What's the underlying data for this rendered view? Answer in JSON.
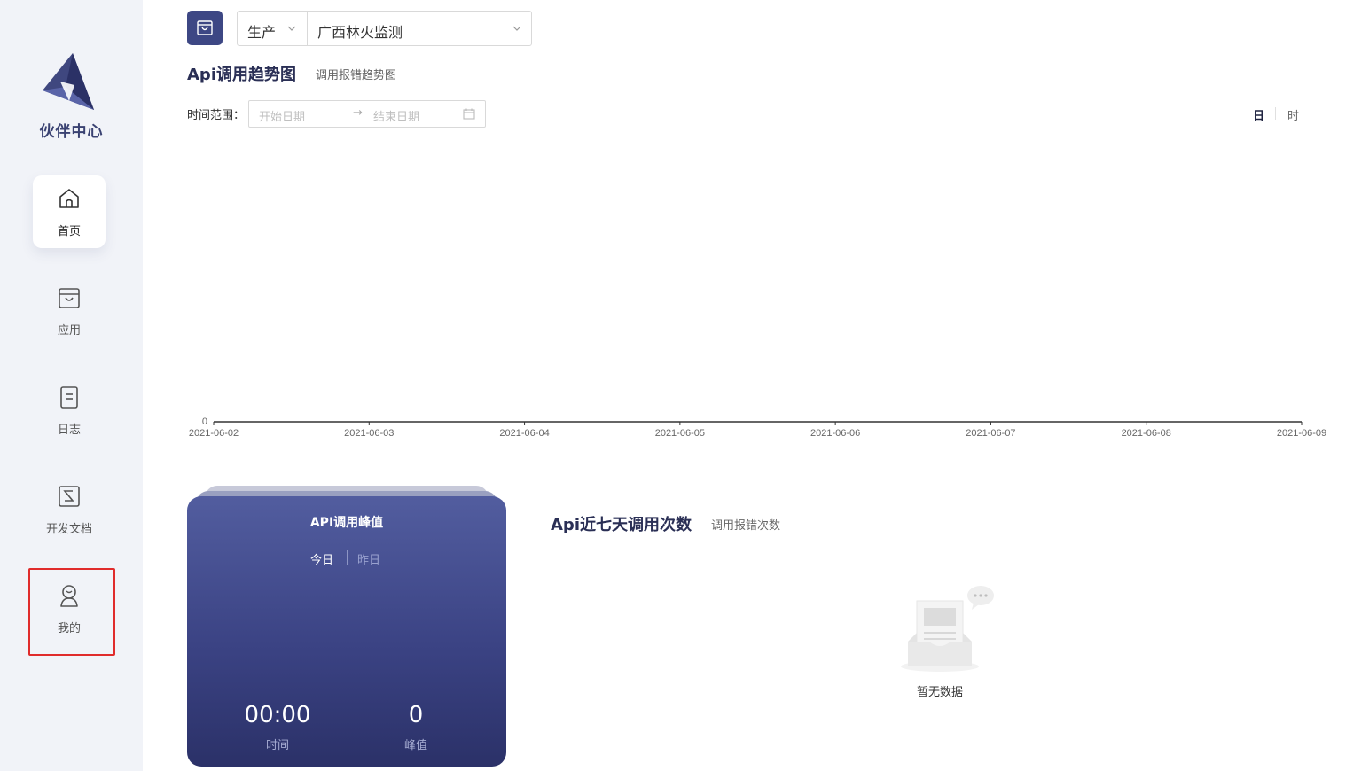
{
  "sidebar": {
    "brand": "伙伴中心",
    "items": [
      {
        "label": "首页",
        "icon": "home-icon"
      },
      {
        "label": "应用",
        "icon": "app-icon"
      },
      {
        "label": "日志",
        "icon": "log-icon"
      },
      {
        "label": "开发文档",
        "icon": "doc-icon"
      },
      {
        "label": "我的",
        "icon": "user-icon"
      }
    ],
    "active_index": 0
  },
  "toolbar": {
    "env_value": "生产",
    "app_value": "广西林火监测"
  },
  "trend": {
    "title": "Api调用趋势图",
    "subtitle": "调用报错趋势图",
    "range_label": "时间范围：",
    "start_placeholder": "开始日期",
    "end_placeholder": "结束日期",
    "arrow": "→",
    "granularity": [
      "日",
      "时"
    ]
  },
  "chart_data": {
    "type": "line",
    "x": [
      "2021-06-02",
      "2021-06-03",
      "2021-06-04",
      "2021-06-05",
      "2021-06-06",
      "2021-06-07",
      "2021-06-08",
      "2021-06-09"
    ],
    "series": [],
    "y_ticks": [
      "0"
    ],
    "title": "",
    "xlabel": "",
    "ylabel": ""
  },
  "peak": {
    "title": "API调用峰值",
    "tabs": [
      "今日",
      "昨日"
    ],
    "time_value": "00:00",
    "time_label": "时间",
    "peak_value": "0",
    "peak_label": "峰值"
  },
  "weekly": {
    "title": "Api近七天调用次数",
    "subtitle": "调用报错次数",
    "empty_text": "暂无数据"
  },
  "colors": {
    "primary": "#3d4784",
    "highlight": "#e02b2b",
    "sidebar_bg": "#f1f3f8"
  }
}
